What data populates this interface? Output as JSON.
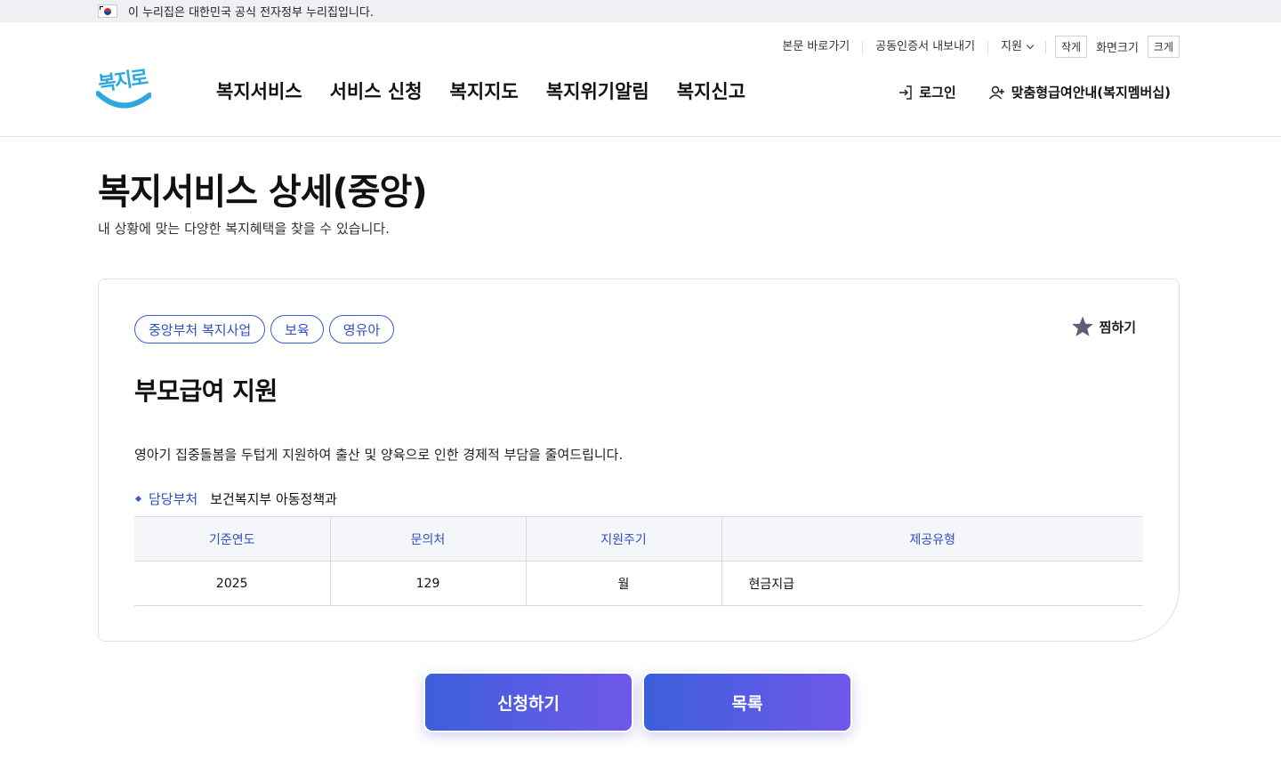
{
  "gov_banner": {
    "text": "이 누리집은 대한민국 공식 전자정부 누리집입니다."
  },
  "header": {
    "util_links": [
      "본문 바로가기",
      "공동인증서 내보내기",
      "지원"
    ],
    "font_size": {
      "small": "작게",
      "label": "화면크기",
      "large": "크게"
    },
    "logo_text": "복지로",
    "nav": [
      "복지서비스",
      "서비스 신청",
      "복지지도",
      "복지위기알림",
      "복지신고"
    ],
    "login": "로그인",
    "membership": "맞춤형급여안내(복지멤버십)"
  },
  "page": {
    "title": "복지서비스 상세(중앙)",
    "description": "내 상황에 맞는 다양한 복지혜택을 찾을 수 있습니다."
  },
  "service": {
    "tags": [
      "중앙부처 복지사업",
      "보육",
      "영유아"
    ],
    "favorite_label": "찜하기",
    "title": "부모급여 지원",
    "description": "영아기 집중돌봄을 두텁게 지원하여 출산 및 양육으로 인한 경제적 부담을 줄여드립니다.",
    "dept_label": "담당부처",
    "dept_value": "보건복지부 아동정책과",
    "table": {
      "headers": [
        "기준연도",
        "문의처",
        "지원주기",
        "제공유형"
      ],
      "row": [
        "2025",
        "129",
        "월",
        "현금지급"
      ]
    }
  },
  "buttons": {
    "apply": "신청하기",
    "list": "목록"
  },
  "colors": {
    "accent": "#3b5bcf",
    "button_start": "#3c5fdc",
    "button_end": "#7058ea",
    "logo": "#2ea7e0"
  }
}
